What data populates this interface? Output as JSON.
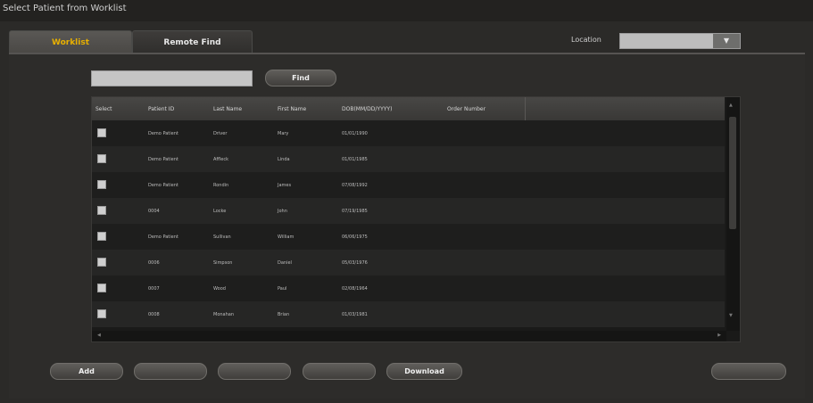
{
  "window": {
    "title": "Select Patient from Worklist"
  },
  "tabs": [
    {
      "label": "Worklist"
    },
    {
      "label": "Remote Find"
    }
  ],
  "location": {
    "label": "Location",
    "value": "",
    "arrow": "▼"
  },
  "search": {
    "value": "",
    "find_label": "Find"
  },
  "table": {
    "columns": [
      "Select",
      "Patient ID",
      "Last Name",
      "First Name",
      "DOB(MM/DD/YYYY)",
      "Order Number"
    ],
    "rows": [
      {
        "patient_id": "Demo Patient",
        "last_name": "Driver",
        "first_name": "Mary",
        "dob": "01/01/1990",
        "order_number": ""
      },
      {
        "patient_id": "Demo Patient",
        "last_name": "Affleck",
        "first_name": "Linda",
        "dob": "01/01/1985",
        "order_number": ""
      },
      {
        "patient_id": "Demo Patient",
        "last_name": "Rondin",
        "first_name": "James",
        "dob": "07/08/1992",
        "order_number": ""
      },
      {
        "patient_id": "0004",
        "last_name": "Locke",
        "first_name": "John",
        "dob": "07/19/1985",
        "order_number": ""
      },
      {
        "patient_id": "Demo Patient",
        "last_name": "Sullivan",
        "first_name": "William",
        "dob": "06/06/1975",
        "order_number": ""
      },
      {
        "patient_id": "0006",
        "last_name": "Simpson",
        "first_name": "Daniel",
        "dob": "05/03/1976",
        "order_number": ""
      },
      {
        "patient_id": "0007",
        "last_name": "Wood",
        "first_name": "Paul",
        "dob": "02/08/1964",
        "order_number": ""
      },
      {
        "patient_id": "0008",
        "last_name": "Monahan",
        "first_name": "Brian",
        "dob": "01/03/1981",
        "order_number": ""
      }
    ]
  },
  "scroll": {
    "up": "▲",
    "down": "▼",
    "left": "◀",
    "right": "▶"
  },
  "buttons": {
    "add": "Add",
    "blank1": "",
    "blank2": "",
    "blank3": "",
    "download": "Download",
    "ok": ""
  }
}
